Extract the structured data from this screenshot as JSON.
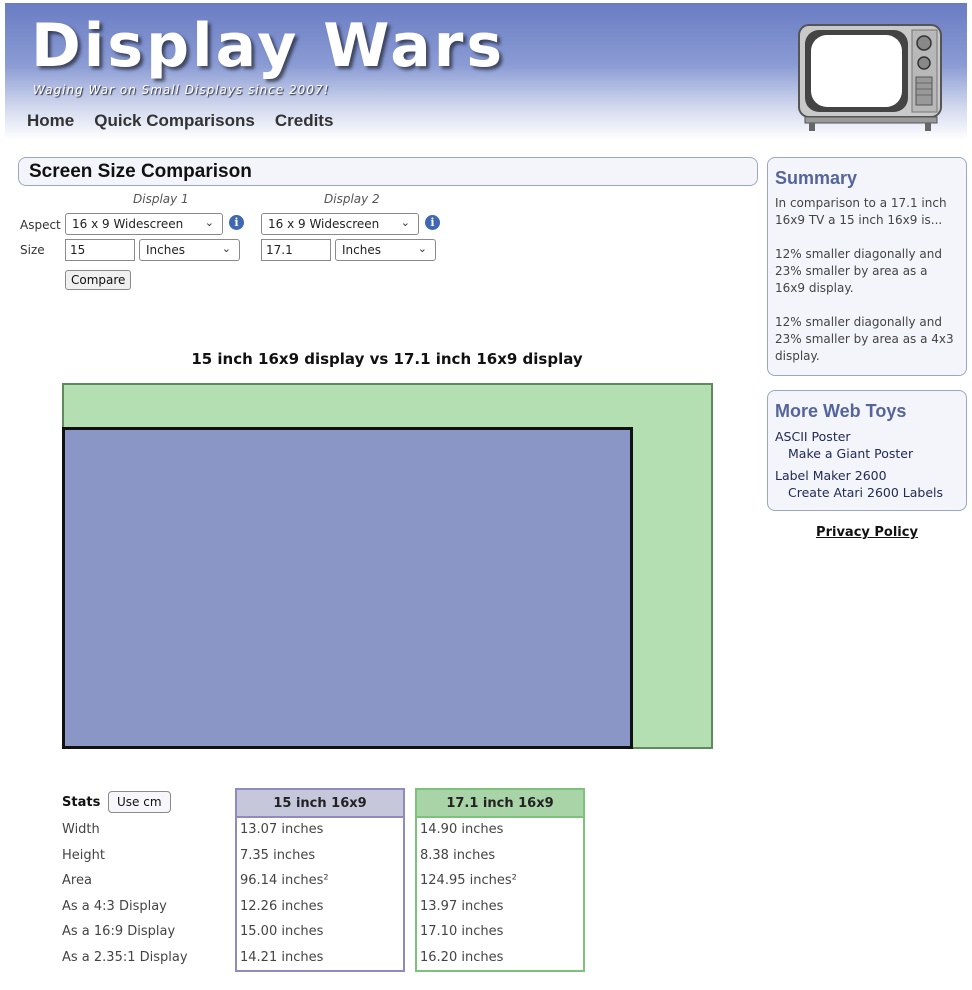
{
  "site": {
    "title": "Display Wars",
    "tagline": "Waging War on Small Displays since 2007!",
    "nav": [
      "Home",
      "Quick Comparisons",
      "Credits"
    ]
  },
  "page_title": "Screen Size Comparison",
  "form": {
    "display1_label": "Display 1",
    "display2_label": "Display 2",
    "aspect_label": "Aspect",
    "size_label": "Size",
    "display1": {
      "aspect": "16 x 9 Widescreen",
      "size": "15",
      "unit": "Inches"
    },
    "display2": {
      "aspect": "16 x 9 Widescreen",
      "size": "17.1",
      "unit": "Inches"
    },
    "compare_button": "Compare",
    "info_glyph": "i"
  },
  "comparison": {
    "title": "15 inch 16x9 display vs 17.1 inch 16x9 display",
    "display1_color": "#8a96c6",
    "display2_color": "#b3dfb2"
  },
  "stats": {
    "label": "Stats",
    "use_cm_button": "Use cm",
    "rows": [
      "Width",
      "Height",
      "Area",
      "As a 4:3 Display",
      "As a 16:9 Display",
      "As a 2.35:1 Display"
    ],
    "display1": {
      "header": "15 inch 16x9",
      "header_bg": "#c6c7db",
      "border": "#8f8ac0",
      "values": [
        "13.07 inches",
        "7.35 inches",
        "96.14 inches²",
        "12.26 inches",
        "15.00 inches",
        "14.21 inches"
      ]
    },
    "display2": {
      "header": "17.1 inch 16x9",
      "header_bg": "#a9d4a8",
      "border": "#7cc27b",
      "values": [
        "14.90 inches",
        "8.38 inches",
        "124.95 inches²",
        "13.97 inches",
        "17.10 inches",
        "16.20 inches"
      ]
    }
  },
  "sidebar": {
    "summary": {
      "title": "Summary",
      "paragraphs": [
        "In comparison to a 17.1 inch 16x9 TV a 15 inch 16x9 is...",
        "12% smaller diagonally and 23% smaller by area as a 16x9 display.",
        "12% smaller diagonally and 23% smaller by area as a 4x3 display."
      ]
    },
    "web_toys": {
      "title": "More Web Toys",
      "items": [
        {
          "label": "ASCII Poster",
          "sub": "Make a Giant Poster"
        },
        {
          "label": "Label Maker 2600",
          "sub": "Create Atari 2600 Labels"
        }
      ]
    },
    "privacy": "Privacy Policy"
  }
}
